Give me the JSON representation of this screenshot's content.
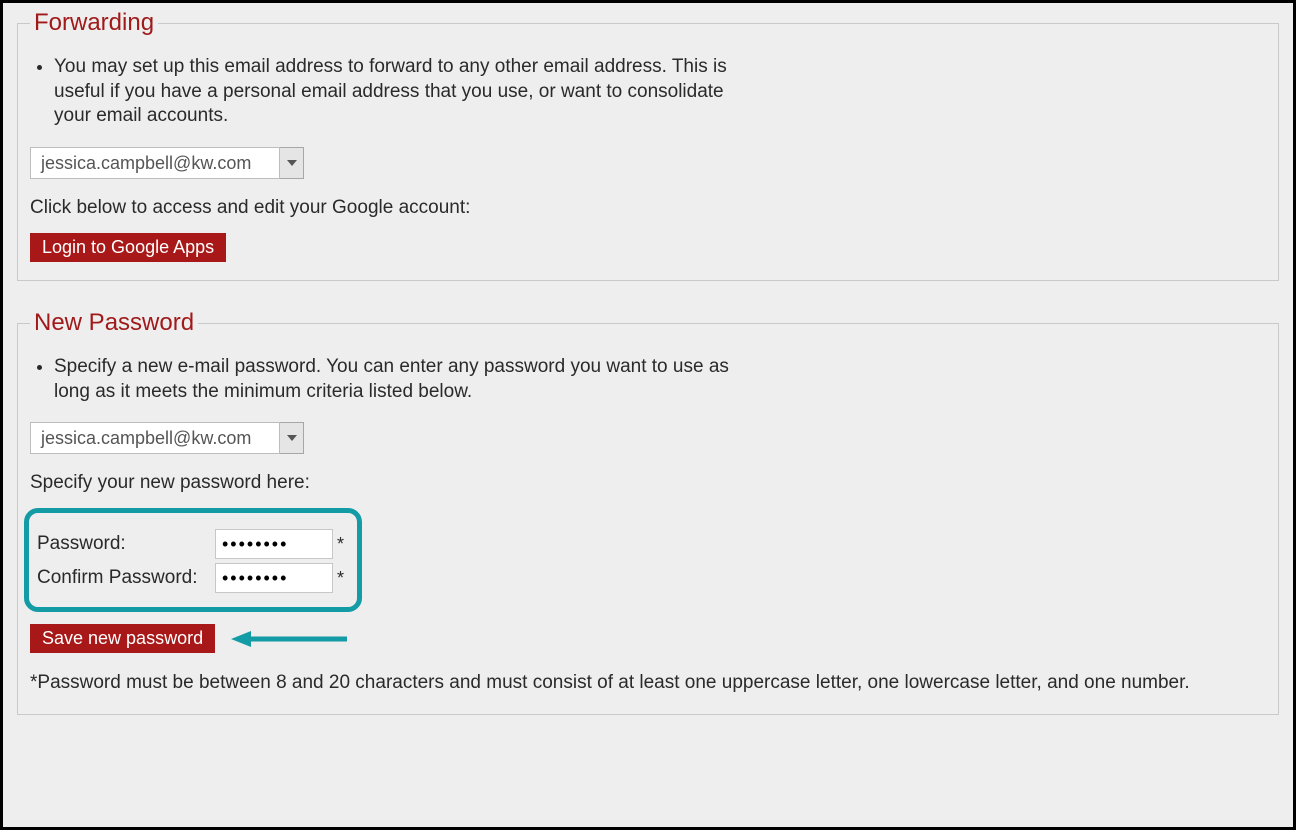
{
  "forwarding": {
    "legend": "Forwarding",
    "bullet": "You may set up this email address to forward to any other email address. This is useful if you have a personal email address that you use, or want to consolidate your email accounts.",
    "selected_email": "jessica.campbell@kw.com",
    "access_text": "Click below to access and edit your Google account:",
    "login_button": "Login to Google Apps"
  },
  "password": {
    "legend": "New Password",
    "bullet": "Specify a new e-mail password. You can enter any password you want to use as long as it meets the minimum criteria listed below.",
    "selected_email": "jessica.campbell@kw.com",
    "specify_text": "Specify your new password here:",
    "password_label": "Password:",
    "confirm_label": "Confirm Password:",
    "password_value": "••••••••",
    "confirm_value": "••••••••",
    "required_mark": "*",
    "save_button": "Save new password",
    "hint": "*Password must be between 8 and 20 characters and must consist of at least one uppercase letter, one lowercase letter, and one number."
  },
  "colors": {
    "accent_red": "#a81818",
    "highlight_teal": "#139ba6"
  }
}
